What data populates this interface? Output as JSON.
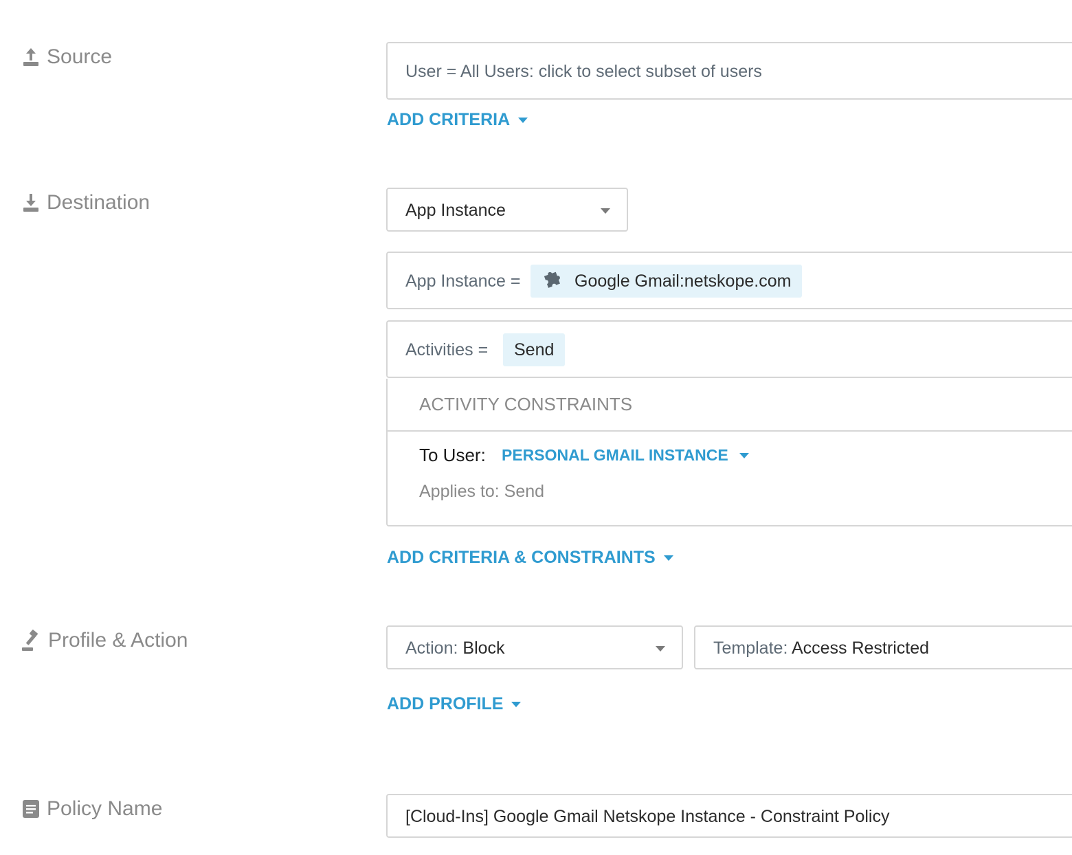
{
  "source": {
    "label": "Source",
    "icon": "upload-icon",
    "user_field": "User = All Users: click to select subset of users",
    "add_criteria": "ADD CRITERIA"
  },
  "destination": {
    "label": "Destination",
    "icon": "download-icon",
    "select_value": "App Instance",
    "app_instance": {
      "prefix": "App Instance =",
      "chip_label": "Google Gmail:netskope.com",
      "chip_icon": "puzzle-icon"
    },
    "activities": {
      "prefix": "Activities =",
      "chip_label": "Send"
    },
    "constraints": {
      "header": "ACTIVITY CONSTRAINTS",
      "to_user_label": "To User:",
      "to_user_value": "PERSONAL GMAIL INSTANCE",
      "applies_to": "Applies to: Send"
    },
    "add_criteria_constraints": "ADD CRITERIA & CONSTRAINTS"
  },
  "profile_action": {
    "label": "Profile & Action",
    "icon": "gavel-icon",
    "action_prefix": "Action:",
    "action_value": "Block",
    "template_prefix": "Template:",
    "template_value": "Access Restricted",
    "add_profile": "ADD PROFILE"
  },
  "policy_name": {
    "label": "Policy Name",
    "icon": "document-icon",
    "value": "[Cloud-Ins] Google Gmail Netskope Instance - Constraint Policy"
  },
  "colors": {
    "accent": "#2f9bd0",
    "chip_bg": "#e4f3fa",
    "label_grey": "#8a8a8a",
    "border": "#d6d6d6"
  }
}
